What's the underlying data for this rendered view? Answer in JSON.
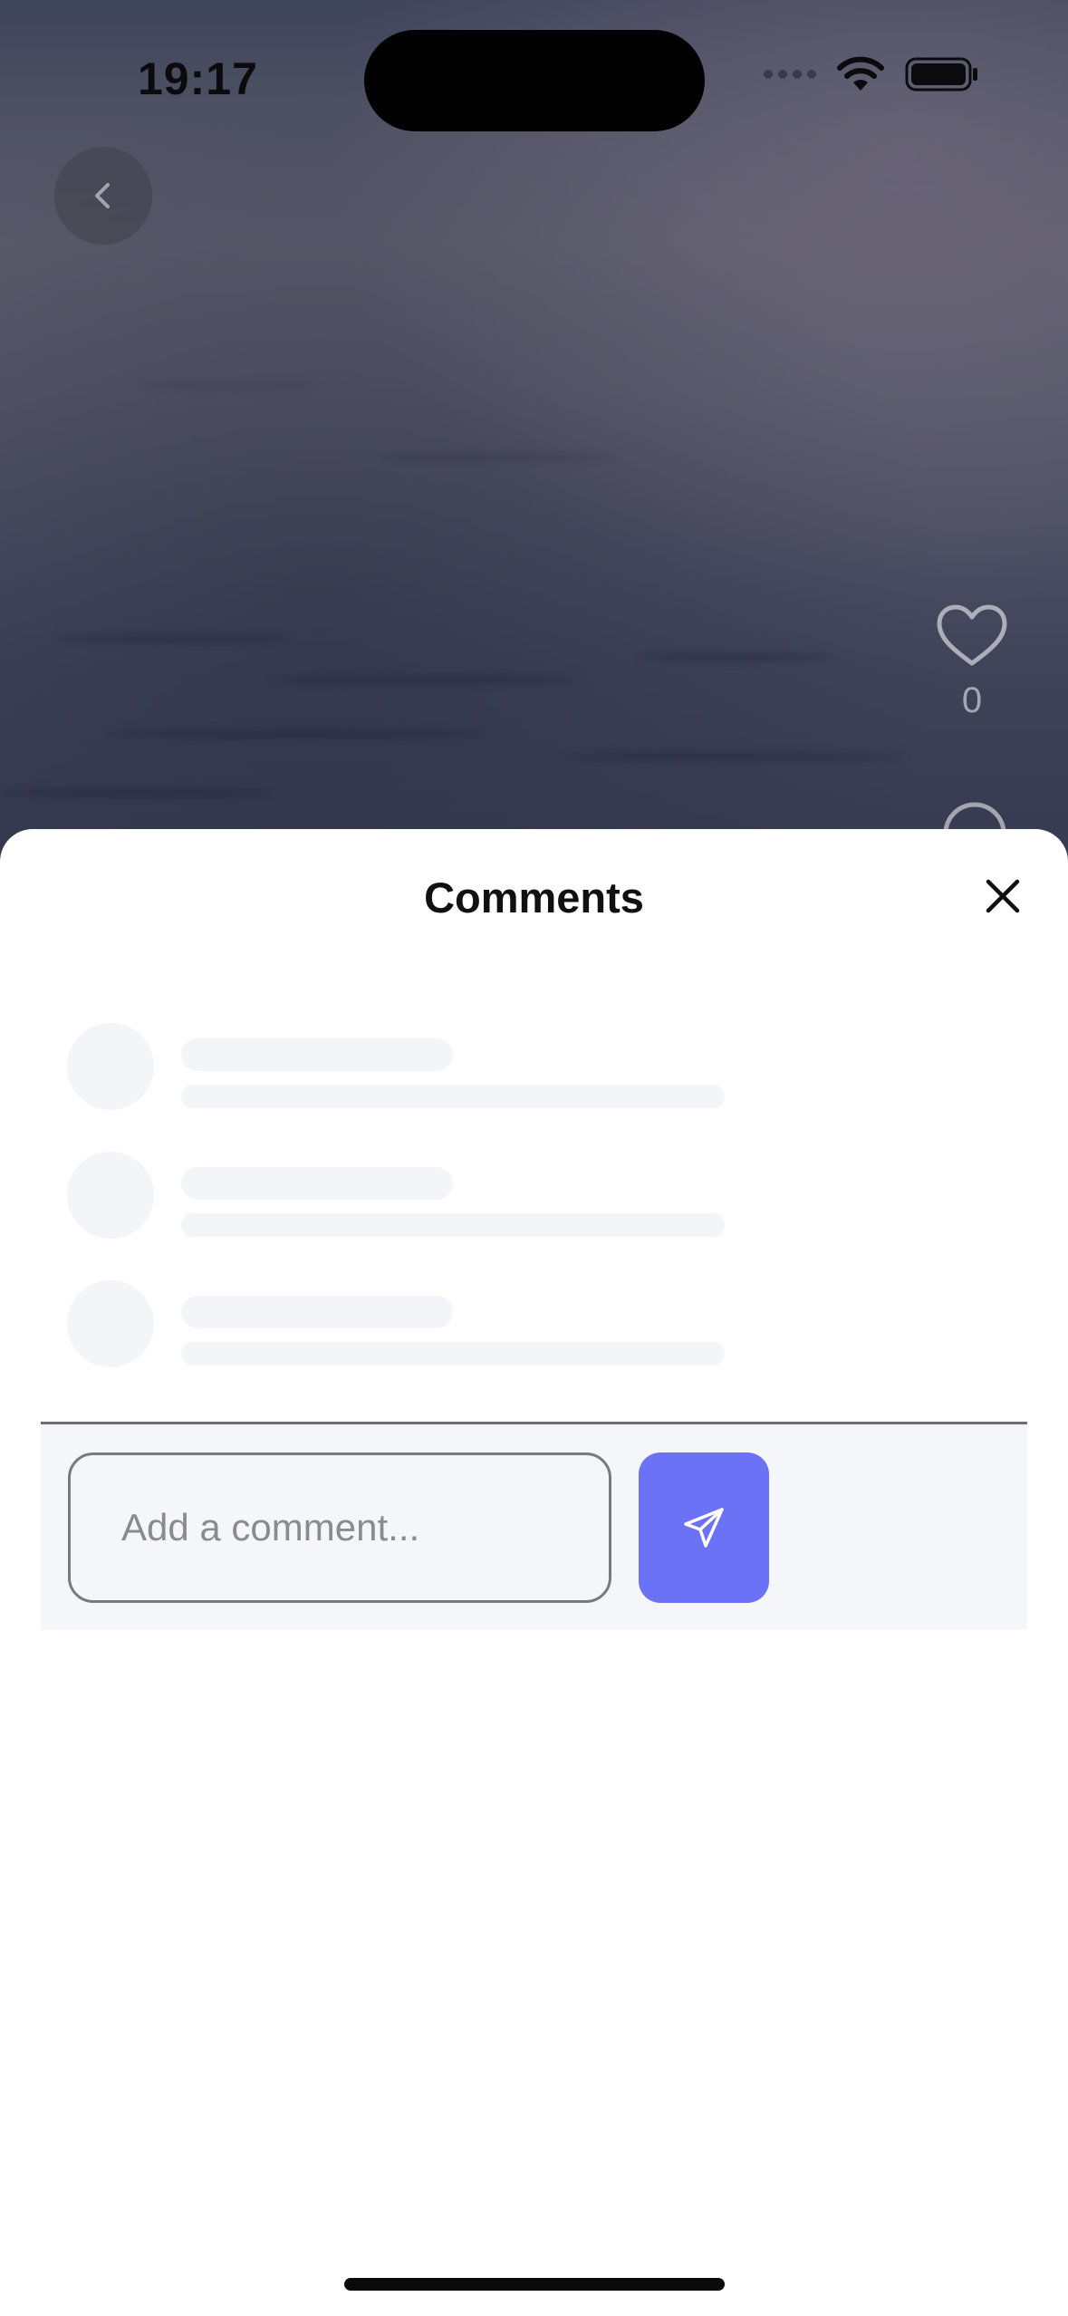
{
  "status_bar": {
    "time": "19:17",
    "icons": [
      "signal-dots-icon",
      "wifi-icon",
      "battery-icon"
    ]
  },
  "video": {
    "back_icon": "chevron-left-icon",
    "like_icon": "heart-icon",
    "like_count": "0",
    "comment_icon": "comment-bubble-icon"
  },
  "comments_sheet": {
    "title": "Comments",
    "close_icon": "close-icon",
    "loading_placeholders": 3,
    "input": {
      "value": "",
      "placeholder": "Add a comment..."
    },
    "send_icon": "send-icon",
    "colors": {
      "accent": "#6c72f5",
      "skeleton": "#f4f5f9",
      "input_bar_bg": "#f5f6fa"
    }
  }
}
